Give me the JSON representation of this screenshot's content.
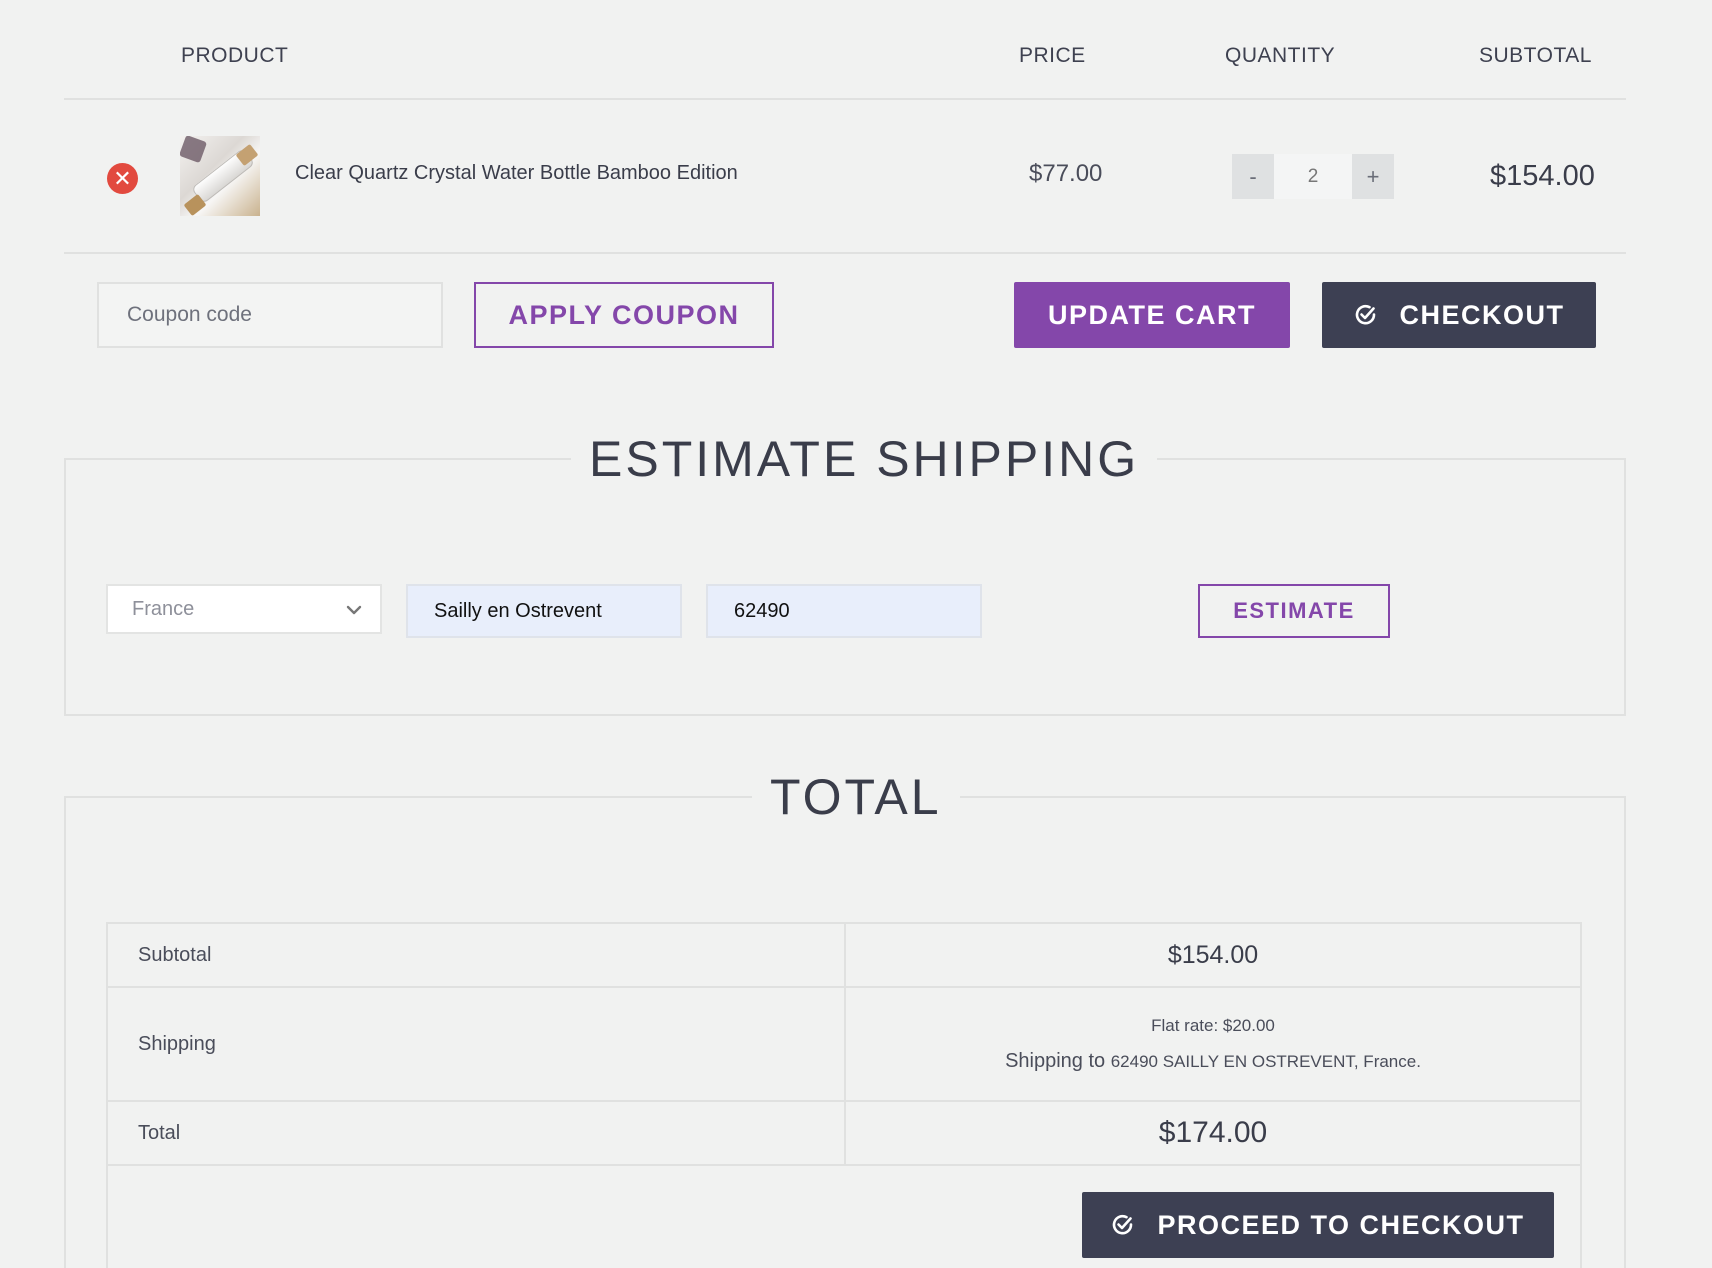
{
  "cart": {
    "headers": {
      "product": "PRODUCT",
      "price": "PRICE",
      "quantity": "QUANTITY",
      "subtotal": "SUBTOTAL"
    },
    "item": {
      "name": "Clear Quartz Crystal Water Bottle Bamboo Edition",
      "price": "$77.00",
      "quantity": "2",
      "subtotal": "$154.00",
      "remove_symbol": "✕",
      "minus": "-",
      "plus": "+"
    }
  },
  "actions": {
    "coupon_placeholder": "Coupon code",
    "apply_coupon": "APPLY COUPON",
    "update_cart": "UPDATE CART",
    "checkout": "CHECKOUT"
  },
  "shipping": {
    "title": "ESTIMATE SHIPPING",
    "country": "France",
    "city": "Sailly en Ostrevent",
    "postcode": "62490",
    "estimate": "ESTIMATE"
  },
  "totals": {
    "title": "TOTAL",
    "rows": {
      "subtotal_label": "Subtotal",
      "subtotal_value": "$154.00",
      "shipping_label": "Shipping",
      "shipping_rate": "Flat rate: $20.00",
      "shipping_to_prefix": "Shipping to",
      "shipping_to_address": "62490 SAILLY EN OSTREVENT, France.",
      "total_label": "Total",
      "total_value": "$174.00"
    },
    "proceed": "PROCEED TO CHECKOUT"
  },
  "colors": {
    "background": "#f1f2f1",
    "accent_purple": "#8447aa",
    "dark_button": "#3d4053",
    "remove_red": "#e24a3f",
    "input_blue": "#e8eefb"
  },
  "icons": {
    "remove": "close-circle-icon",
    "check": "check-circle-icon",
    "select": "chevron-down-icon"
  }
}
